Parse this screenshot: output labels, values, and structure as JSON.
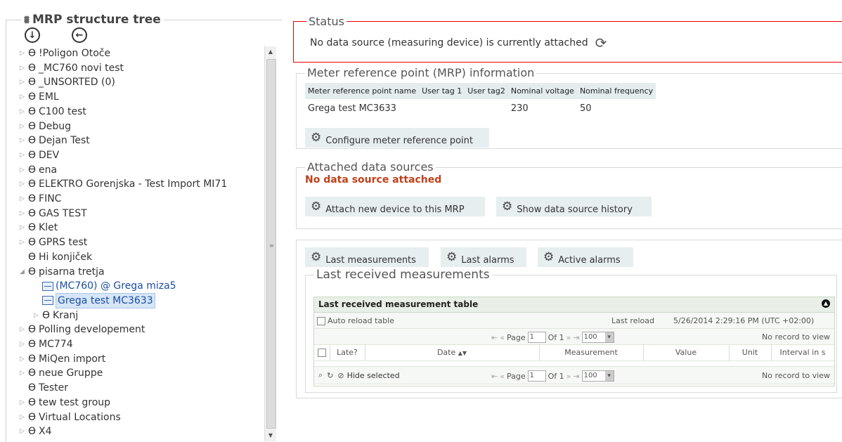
{
  "tree": {
    "title": "MRP structure tree",
    "items": [
      {
        "label": "!Poligon Otoče",
        "expander": "▷",
        "icon": "Ө",
        "indent": 0
      },
      {
        "label": "_MC760 novi test",
        "expander": "▷",
        "icon": "Ө",
        "indent": 0
      },
      {
        "label": "_UNSORTED (0)",
        "expander": "▷",
        "icon": "Ө",
        "indent": 0
      },
      {
        "label": "EML",
        "expander": "▷",
        "icon": "Ө",
        "indent": 0
      },
      {
        "label": "C100 test",
        "expander": "▷",
        "icon": "Ө",
        "indent": 0
      },
      {
        "label": "Debug",
        "expander": "▷",
        "icon": "Ө",
        "indent": 0
      },
      {
        "label": "Dejan Test",
        "expander": "▷",
        "icon": "Ө",
        "indent": 0
      },
      {
        "label": "DEV",
        "expander": "▷",
        "icon": "Ө",
        "indent": 0
      },
      {
        "label": "ena",
        "expander": "▷",
        "icon": "Ө",
        "indent": 0
      },
      {
        "label": "ELEKTRO Gorenjska - Test Import MI71",
        "expander": "▷",
        "icon": "Ө",
        "indent": 0
      },
      {
        "label": "FINC",
        "expander": "▷",
        "icon": "Ө",
        "indent": 0
      },
      {
        "label": "GAS TEST",
        "expander": "▷",
        "icon": "Ө",
        "indent": 0
      },
      {
        "label": "Klet",
        "expander": "▷",
        "icon": "Ө",
        "indent": 0
      },
      {
        "label": "GPRS test",
        "expander": "▷",
        "icon": "Ө",
        "indent": 0
      },
      {
        "label": "Hi konjiček",
        "expander": "",
        "icon": "Ө",
        "indent": 0
      },
      {
        "label": "pisarna tretja",
        "expander": "◢",
        "icon": "Ө",
        "indent": 0
      },
      {
        "label": "(MC760) @ Grega miza5",
        "expander": "",
        "icon": "device",
        "indent": 1
      },
      {
        "label": "Grega test MC3633",
        "expander": "",
        "icon": "device",
        "indent": 1,
        "selected": true
      },
      {
        "label": "Kranj",
        "expander": "▷",
        "icon": "Ө",
        "indent": 1
      },
      {
        "label": "Polling developement",
        "expander": "▷",
        "icon": "Ө",
        "indent": 0
      },
      {
        "label": "MC774",
        "expander": "▷",
        "icon": "Ө",
        "indent": 0
      },
      {
        "label": "MiQen import",
        "expander": "▷",
        "icon": "Ө",
        "indent": 0
      },
      {
        "label": "neue Gruppe",
        "expander": "▷",
        "icon": "Ө",
        "indent": 0
      },
      {
        "label": "Tester",
        "expander": "",
        "icon": "Ө",
        "indent": 0
      },
      {
        "label": "tew test group",
        "expander": "▷",
        "icon": "Ө",
        "indent": 0
      },
      {
        "label": "Virtual Locations",
        "expander": "▷",
        "icon": "Ө",
        "indent": 0
      },
      {
        "label": "X4",
        "expander": "▷",
        "icon": "Ө",
        "indent": 0
      }
    ]
  },
  "status": {
    "legend": "Status",
    "text": "No data source (measuring device) is currently attached"
  },
  "mrp": {
    "legend": "Meter reference point (MRP) information",
    "headers": [
      "Meter reference point name",
      "User tag 1",
      "User tag2",
      "Nominal voltage",
      "Nominal frequency"
    ],
    "row": [
      "Grega test MC3633",
      "",
      "",
      "230",
      "50"
    ],
    "configure_label": "Configure meter reference point"
  },
  "sources": {
    "legend": "Attached data sources",
    "none_text": "No data source attached",
    "attach_label": "Attach new device to this MRP",
    "history_label": "Show data source history"
  },
  "measure": {
    "tabs": [
      "Last measurements",
      "Last alarms",
      "Active alarms"
    ],
    "legend": "Last received measurements",
    "table_title": "Last received measurement table",
    "auto_reload": "Auto reload table",
    "last_reload_label": "Last reload",
    "last_reload_value": "5/26/2014 2:29:16 PM (UTC +02:00)",
    "page_label": "Page",
    "page_value": "1",
    "of_label": "Of 1",
    "page_size": "100",
    "no_records": "No record to view",
    "columns": [
      "Late?",
      "Date",
      "Measurement",
      "Value",
      "Unit",
      "Interval in s"
    ],
    "hide_selected": "Hide selected"
  }
}
